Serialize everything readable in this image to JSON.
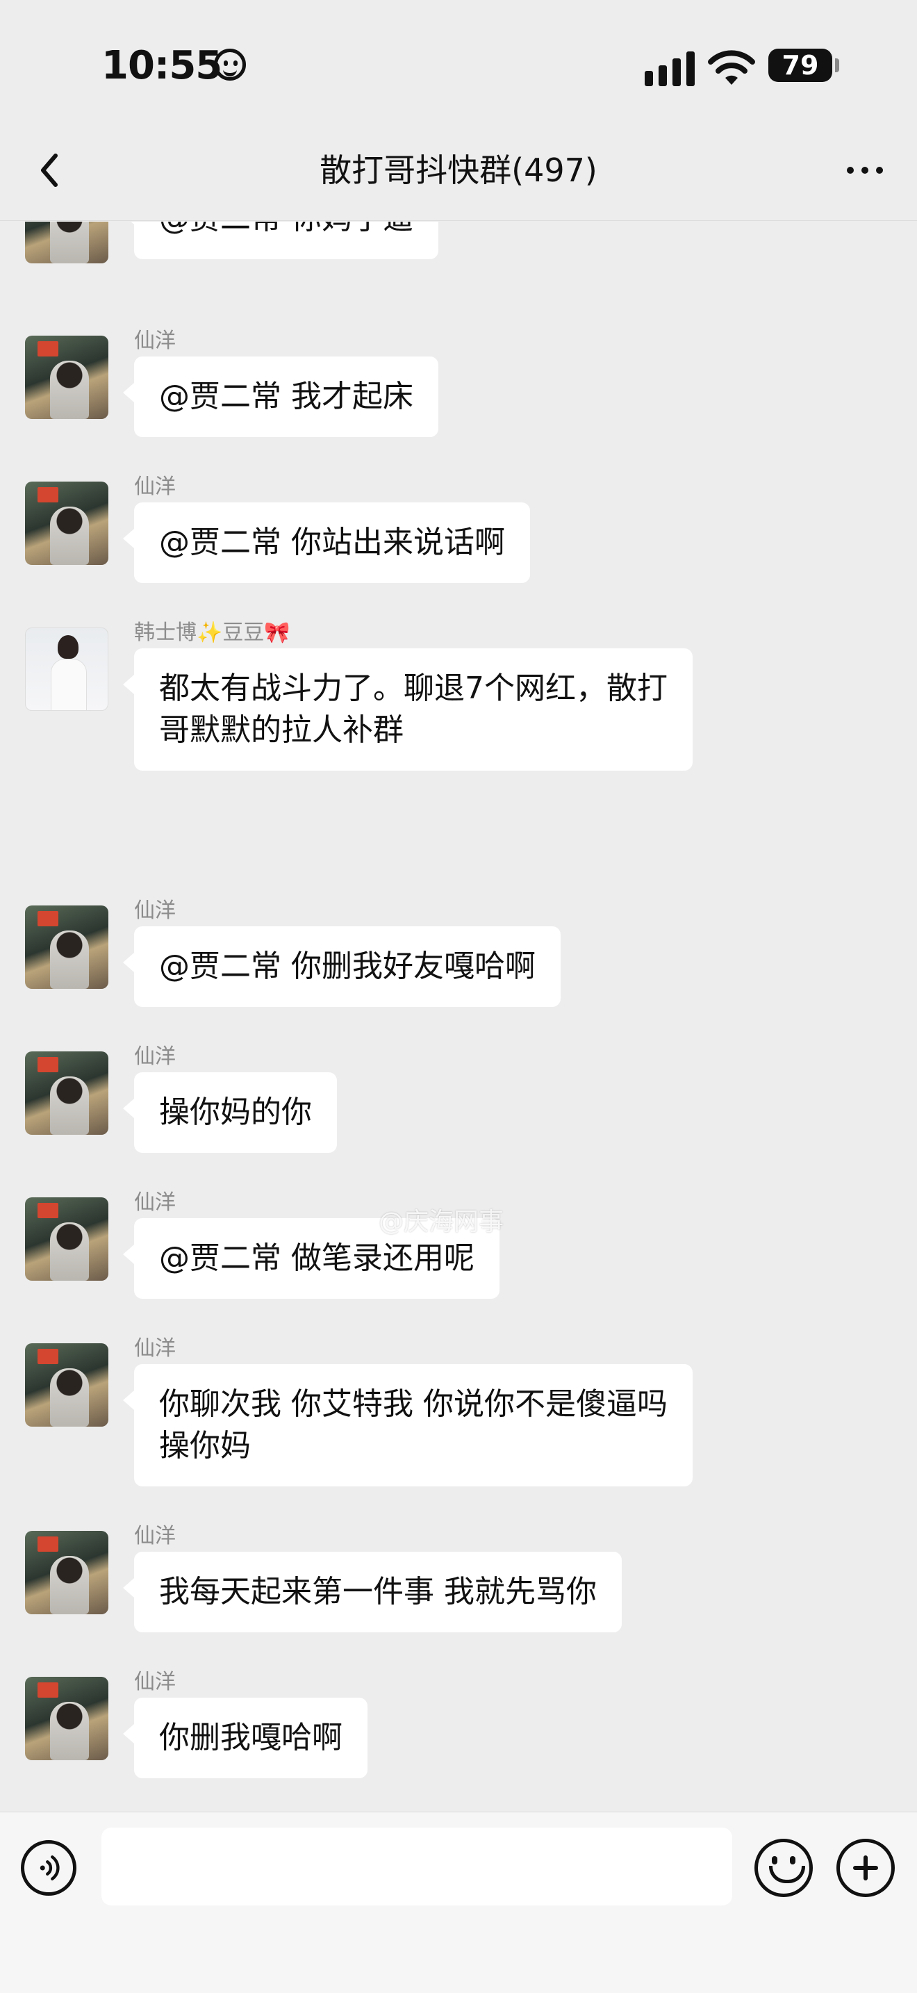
{
  "status_bar": {
    "time": "10:55",
    "battery": "79"
  },
  "header": {
    "title": "散打哥抖快群(497)"
  },
  "messages": [
    {
      "sender": "",
      "text": "@贾二常 你妈了逼",
      "avatar": "photo"
    },
    {
      "sender": "仙洋",
      "text": "@贾二常 我才起床",
      "avatar": "photo"
    },
    {
      "sender": "仙洋",
      "text": "@贾二常 你站出来说话啊",
      "avatar": "photo"
    },
    {
      "sender": "韩士博✨豆豆🎀",
      "text": "都太有战斗力了。聊退7个网红，散打\n哥默默的拉人补群",
      "avatar": "girl"
    },
    {
      "sender": "仙洋",
      "text": "@贾二常 你删我好友嘎哈啊",
      "avatar": "photo"
    },
    {
      "sender": "仙洋",
      "text": "操你妈的你",
      "avatar": "photo"
    },
    {
      "sender": "仙洋",
      "text": "@贾二常 做笔录还用呢",
      "avatar": "photo"
    },
    {
      "sender": "仙洋",
      "text": "你聊次我 你艾特我 你说你不是傻逼吗\n操你妈",
      "avatar": "photo"
    },
    {
      "sender": "仙洋",
      "text": "我每天起来第一件事 我就先骂你",
      "avatar": "photo"
    },
    {
      "sender": "仙洋",
      "text": "你删我嘎哈啊",
      "avatar": "photo"
    }
  ],
  "watermark": "@庆海网事",
  "input": {
    "placeholder": ""
  },
  "icons": {
    "back": "chevron-left-icon",
    "more": "more-dots-icon",
    "voice": "voice-icon",
    "emoji": "emoji-icon",
    "plus": "plus-icon"
  }
}
